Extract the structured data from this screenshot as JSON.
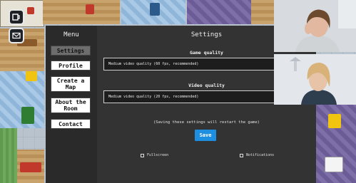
{
  "menu": {
    "title": "Menu",
    "items": [
      {
        "label": "Settings",
        "active": true
      },
      {
        "label": "Profile",
        "active": false
      },
      {
        "label": "Create a Map",
        "active": false
      },
      {
        "label": "About the Room",
        "active": false
      },
      {
        "label": "Contact",
        "active": false
      }
    ]
  },
  "settings": {
    "title": "Settings",
    "game_quality": {
      "label": "Game quality",
      "value": "Medium video quality (60 fps, recommended)"
    },
    "video_quality": {
      "label": "Video quality",
      "value": "Medium video quality (20 fps, recommended)"
    },
    "restart_note": "(Saving these settings will restart the game)",
    "save_label": "Save",
    "fullscreen_label": "Fullscreen",
    "notifications_label": "Notifications"
  },
  "hud": {
    "icons": [
      "mug-icon",
      "mail-icon"
    ]
  },
  "video_tiles": 2,
  "colors": {
    "accent": "#1e8ee0",
    "panel": "#333333",
    "menu_panel": "#2a2a2a"
  }
}
